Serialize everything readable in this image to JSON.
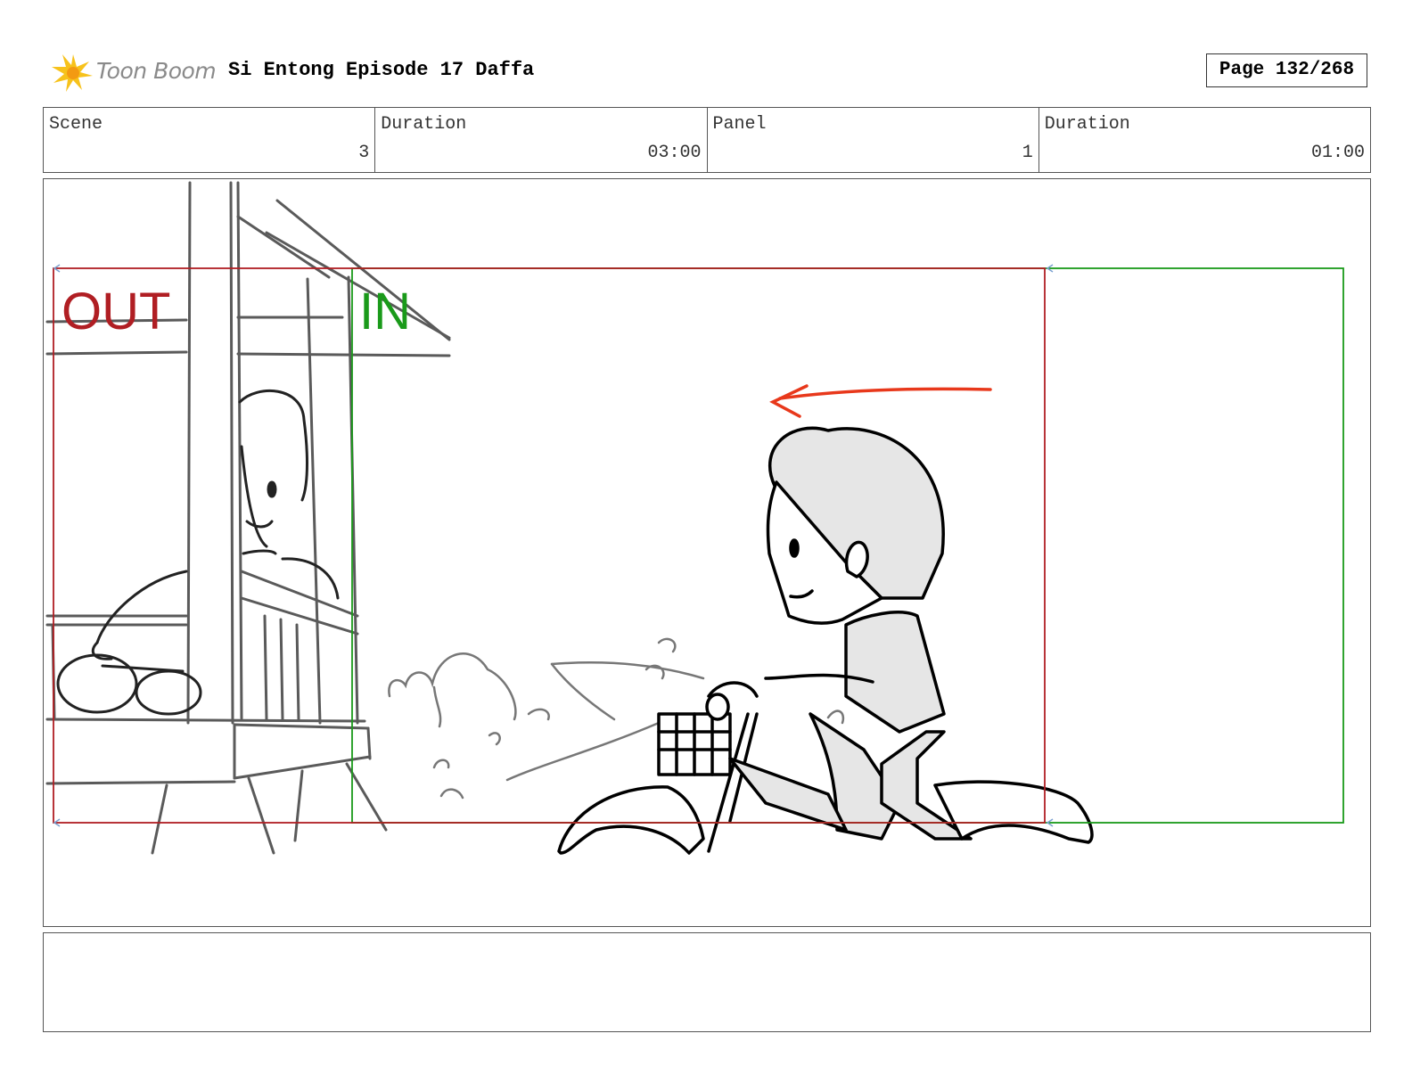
{
  "header": {
    "logo_text": "Toon Boom",
    "project_title": "Si Entong Episode 17 Daffa",
    "page_label": "Page 132/268"
  },
  "info": {
    "scene_label": "Scene",
    "scene_value": "3",
    "scene_duration_label": "Duration",
    "scene_duration_value": "03:00",
    "panel_label": "Panel",
    "panel_value": "1",
    "panel_duration_label": "Duration",
    "panel_duration_value": "01:00"
  },
  "panel_frame": {
    "out_label": "OUT",
    "in_label": "IN",
    "out_color": "#b01e23",
    "in_color": "#1a9a1a",
    "arrow_color": "#e8381b"
  },
  "notes": {
    "text": ""
  }
}
